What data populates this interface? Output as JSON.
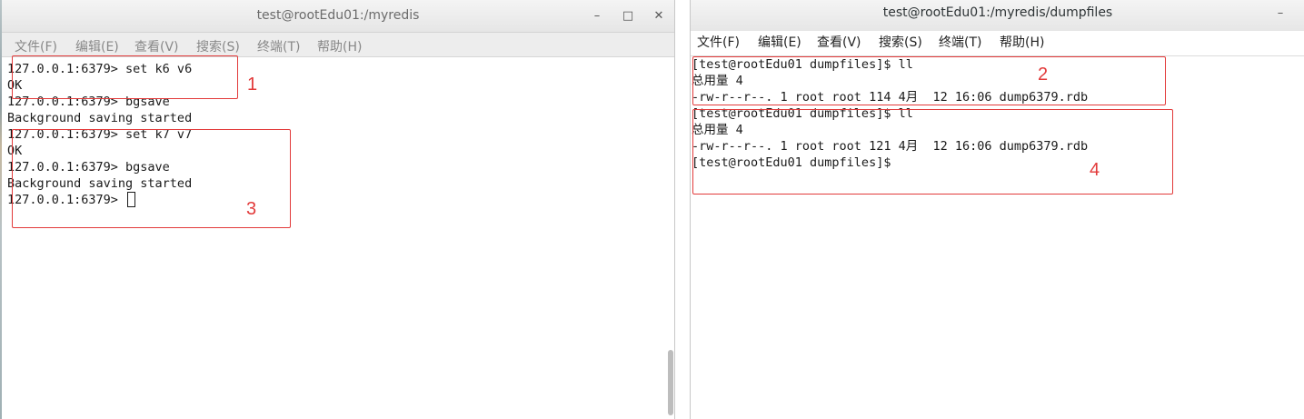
{
  "left_window": {
    "title": "test@rootEdu01:/myredis",
    "controls": {
      "minimize": "–",
      "maximize": "□",
      "close": "✕"
    },
    "menu": [
      "文件(F)",
      "编辑(E)",
      "查看(V)",
      "搜索(S)",
      "终端(T)",
      "帮助(H)"
    ],
    "lines": [
      "127.0.0.1:6379> set k6 v6",
      "OK",
      "127.0.0.1:6379> bgsave",
      "Background saving started",
      "127.0.0.1:6379> set k7 v7",
      "OK",
      "127.0.0.1:6379> bgsave",
      "Background saving started",
      "127.0.0.1:6379> "
    ]
  },
  "right_window": {
    "title": "test@rootEdu01:/myredis/dumpfiles",
    "controls": {
      "minimize": "–"
    },
    "menu": [
      "文件(F)",
      "编辑(E)",
      "查看(V)",
      "搜索(S)",
      "终端(T)",
      "帮助(H)"
    ],
    "lines": [
      "[test@rootEdu01 dumpfiles]$ ll",
      "总用量 4",
      "-rw-r--r--. 1 root root 114 4月  12 16:06 dump6379.rdb",
      "[test@rootEdu01 dumpfiles]$ ll",
      "总用量 4",
      "-rw-r--r--. 1 root root 121 4月  12 16:06 dump6379.rdb",
      "[test@rootEdu01 dumpfiles]$"
    ]
  },
  "annotations": {
    "color": "#e23a3a",
    "labels": [
      "1",
      "2",
      "3",
      "4"
    ]
  }
}
